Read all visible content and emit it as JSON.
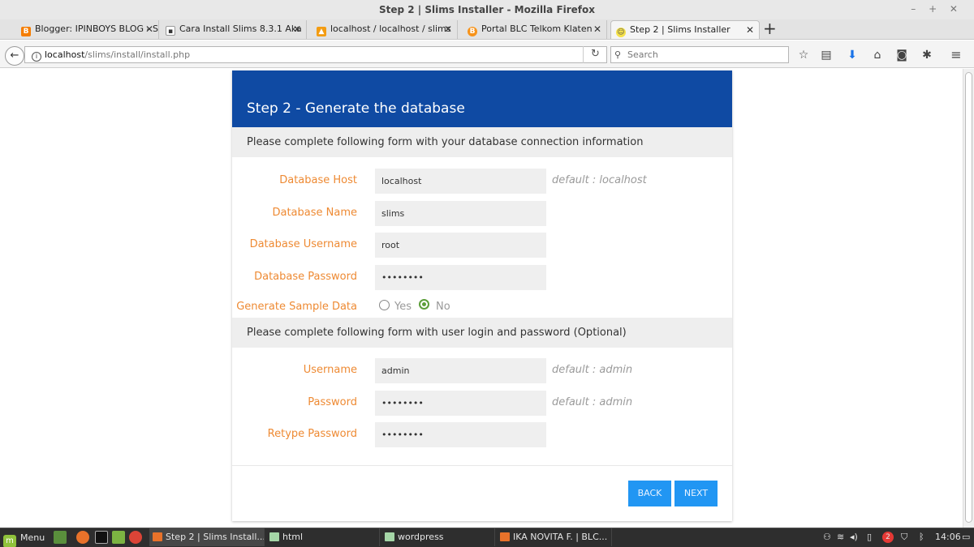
{
  "window": {
    "title": "Step 2 | Slims Installer - Mozilla Firefox",
    "controls": "– + ✕"
  },
  "tabs": [
    {
      "label": "Blogger: IPINBOYS BLOG - S",
      "icon": "blogger-icon"
    },
    {
      "label": "Cara Install Slims 8.3.1 Aka",
      "icon": "page-icon"
    },
    {
      "label": "localhost / localhost / slims",
      "icon": "phpmyadmin-icon"
    },
    {
      "label": "Portal BLC Telkom Klaten",
      "icon": "bitcoin-icon"
    },
    {
      "label": "Step 2 | Slims Installer",
      "icon": "slims-icon"
    }
  ],
  "navbar": {
    "url_host": "localhost",
    "url_path": "/slims/install/install.php",
    "search_placeholder": "Search"
  },
  "page": {
    "header_title": "Step 2 - Generate the database",
    "db_section_text": "Please complete following form with your database connection information",
    "user_section_text": "Please complete following form with user login and password (Optional)",
    "db_fields": [
      {
        "label": "Database Host",
        "value": "localhost",
        "hint": "default : localhost"
      },
      {
        "label": "Database Name",
        "value": "slims",
        "hint": ""
      },
      {
        "label": "Database Username",
        "value": "root",
        "hint": ""
      },
      {
        "label": "Database Password",
        "value": "••••••••",
        "hint": ""
      }
    ],
    "sample_data": {
      "label": "Generate Sample Data",
      "yes_label": "Yes",
      "no_label": "No",
      "selected": "No"
    },
    "user_fields": [
      {
        "label": "Username",
        "value": "admin",
        "hint": "default : admin"
      },
      {
        "label": "Password",
        "value": "••••••••",
        "hint": "default : admin"
      },
      {
        "label": "Retype Password",
        "value": "••••••••",
        "hint": ""
      }
    ],
    "back_label": "BACK",
    "next_label": "NEXT"
  },
  "taskbar": {
    "menu_label": "Menu",
    "tasks": [
      {
        "label": "Step 2 | Slims Install...",
        "active": true
      },
      {
        "label": "html",
        "active": false
      },
      {
        "label": "wordpress",
        "active": false
      },
      {
        "label": "IKA NOVITA F. | BLC...",
        "active": false
      }
    ],
    "notification_count": "2",
    "clock": "14:06"
  },
  "colors": {
    "header_blue": "#0f4aa3",
    "label_orange": "#ee8a33",
    "button_blue": "#2196f3",
    "radio_green": "#5c9e3a"
  }
}
